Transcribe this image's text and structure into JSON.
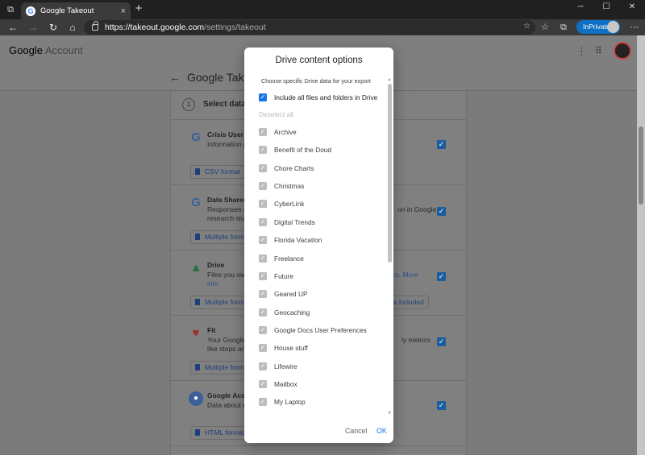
{
  "browser": {
    "tab_title": "Google Takeout",
    "url_host": "https://takeout.google.com",
    "url_path": "/settings/takeout",
    "inprivate_label": "InPrivate"
  },
  "page": {
    "logo_google": "Google",
    "logo_account": "Account",
    "title": "Google Takeout",
    "step_number": "1",
    "step_label": "Select data t"
  },
  "products": [
    {
      "name": "Crisis User R",
      "desc": "Information p",
      "chip": "CSV format"
    },
    {
      "name": "Data Shared",
      "desc_line1": "Responses s",
      "desc_right1": "on in Google",
      "desc_line2": "research stu",
      "chip": "Multiple form"
    },
    {
      "name": "Drive",
      "desc_line1": "Files you ow",
      "desc_right1": "ers. More",
      "desc_line2": "info",
      "chip": "Multiple form",
      "chip2": "ata included"
    },
    {
      "name": "Fit",
      "desc_line1": "Your Google",
      "desc_right1": "ly metrics",
      "desc_line2": "like steps an",
      "chip": "Multiple form"
    },
    {
      "name": "Google Acco",
      "desc": "Data about r",
      "chip": "HTML format"
    }
  ],
  "dialog": {
    "title": "Drive content options",
    "subtitle": "Choose specific Drive data for your export",
    "include_all_label": "Include all files and folders in Drive",
    "deselect_all": "Deselect all",
    "folders": [
      "Archive",
      "Benefit of the Doud",
      "Chore Charts",
      "Christmas",
      "CyberLink",
      "Digital Trends",
      "Florida Vacation",
      "Freelance",
      "Future",
      "Geared UP",
      "Geocaching",
      "Google Docs User Preferences",
      "House stuff",
      "Lifewire",
      "Mailbox",
      "My Laptop"
    ],
    "cancel_label": "Cancel",
    "ok_label": "OK"
  },
  "colors": {
    "accent": "#1a73e8",
    "inprivate": "#0e71c5",
    "overlay": "#7b7b7b"
  }
}
